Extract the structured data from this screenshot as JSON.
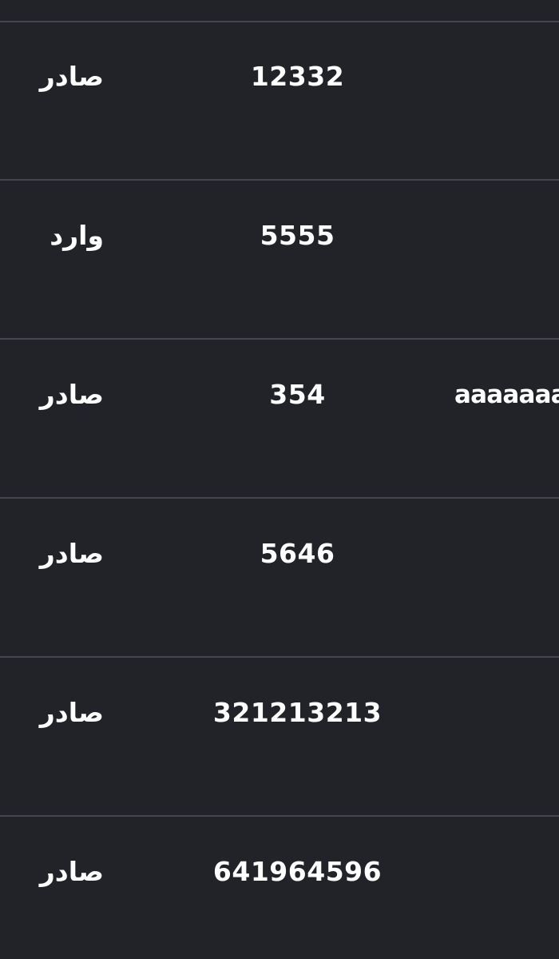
{
  "table": {
    "rows": [
      {
        "type": "صادر",
        "number": "12332",
        "extra": ""
      },
      {
        "type": "وارد",
        "number": "5555",
        "extra": ""
      },
      {
        "type": "صادر",
        "number": "354",
        "extra": "aaaaaaa"
      },
      {
        "type": "صادر",
        "number": "5646",
        "extra": ""
      },
      {
        "type": "صادر",
        "number": "321213213",
        "extra": ""
      },
      {
        "type": "صادر",
        "number": "641964596",
        "extra": ""
      }
    ]
  },
  "colors": {
    "background": "#212328",
    "divider": "#43464c",
    "text": "#ffffff"
  }
}
